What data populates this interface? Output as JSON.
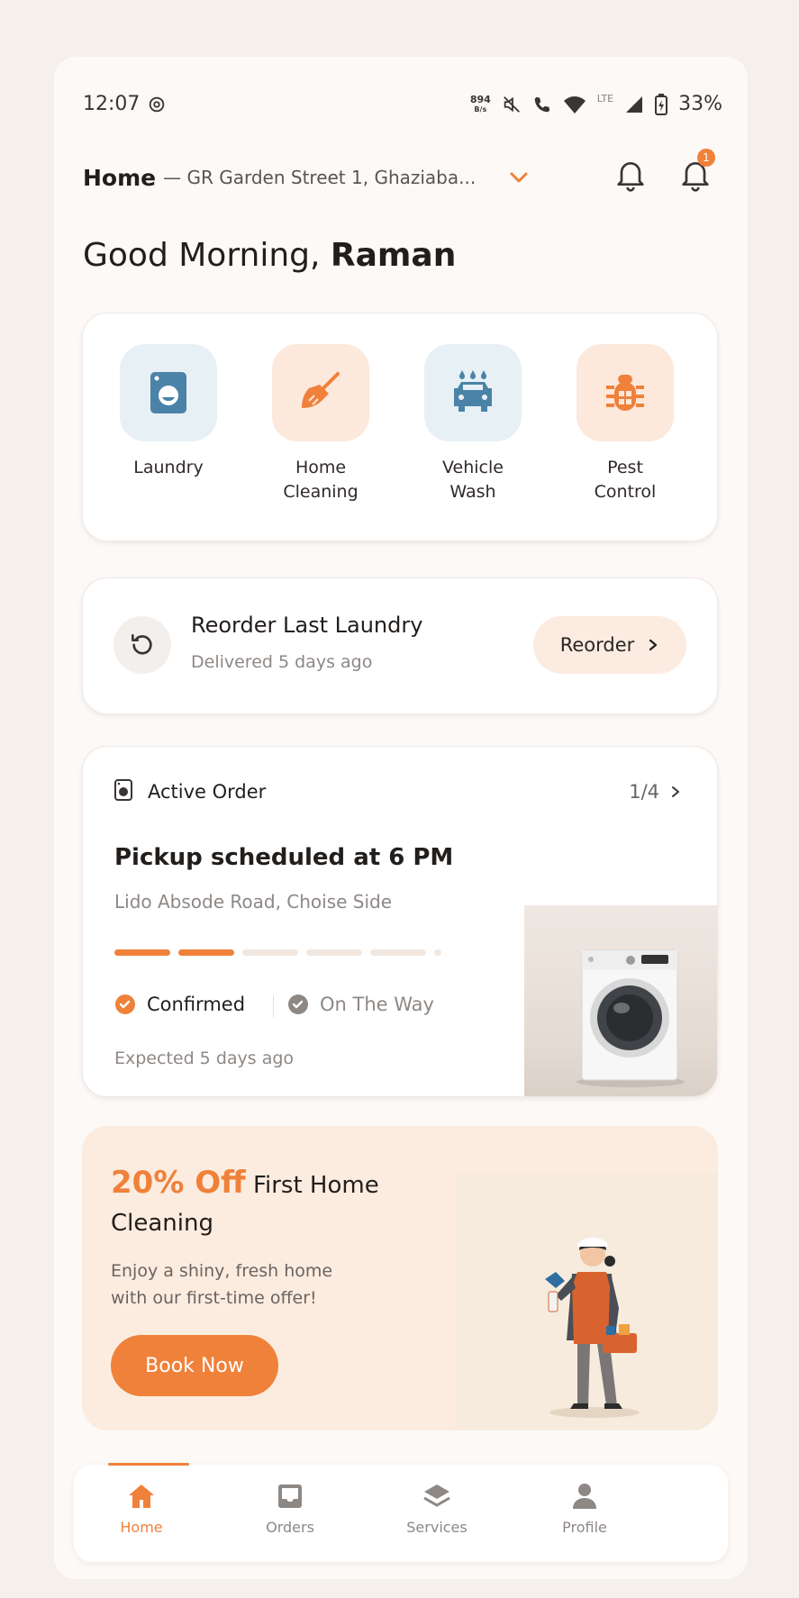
{
  "status_bar": {
    "time": "12:07",
    "net_speed_value": "894",
    "net_speed_unit": "B/s",
    "network": "LTE",
    "battery": "33%"
  },
  "header": {
    "location_label": "Home",
    "address": "— GR Garden Street 1, Ghaziaba...",
    "notification_count": "1"
  },
  "greeting": {
    "prefix": "Good Morning,",
    "name": "Raman"
  },
  "services": [
    {
      "line1": "Laundry",
      "line2": "",
      "icon": "washing-machine-icon",
      "color": "#4b83a8"
    },
    {
      "line1": "Home",
      "line2": "Cleaning",
      "icon": "broom-icon",
      "color": "#f0813a"
    },
    {
      "line1": "Vehicle",
      "line2": "Wash",
      "icon": "car-wash-icon",
      "color": "#4b83a8"
    },
    {
      "line1": "Pest",
      "line2": "Control",
      "icon": "bug-icon",
      "color": "#f0813a"
    }
  ],
  "reorder": {
    "title": "Reorder Last Laundry",
    "subtitle": "Delivered 5 days ago",
    "button": "Reorder"
  },
  "active_order": {
    "header": "Active Order",
    "pager": "1/4",
    "title": "Pickup scheduled at 6 PM",
    "address": "Lido Absode Road, Choise Side",
    "progress_steps_total": 6,
    "progress_steps_done": 2,
    "status_done": "Confirmed",
    "status_next": "On The Way",
    "expected": "Expected 5 days ago"
  },
  "promo": {
    "highlight": "20% Off",
    "title_rest": "First Home",
    "title_line2": "Cleaning",
    "desc_line1": "Enjoy a shiny, fresh home",
    "desc_line2": "with our first-time offer!",
    "button": "Book Now"
  },
  "bottom_nav": [
    {
      "label": "Home",
      "icon": "home-icon",
      "active": true
    },
    {
      "label": "Orders",
      "icon": "inbox-icon",
      "active": false
    },
    {
      "label": "Services",
      "icon": "layers-icon",
      "active": false
    },
    {
      "label": "Profile",
      "icon": "user-icon",
      "active": false
    }
  ],
  "colors": {
    "accent": "#f0813a",
    "service_blue": "#4b83a8",
    "background": "#fcf9f7"
  }
}
